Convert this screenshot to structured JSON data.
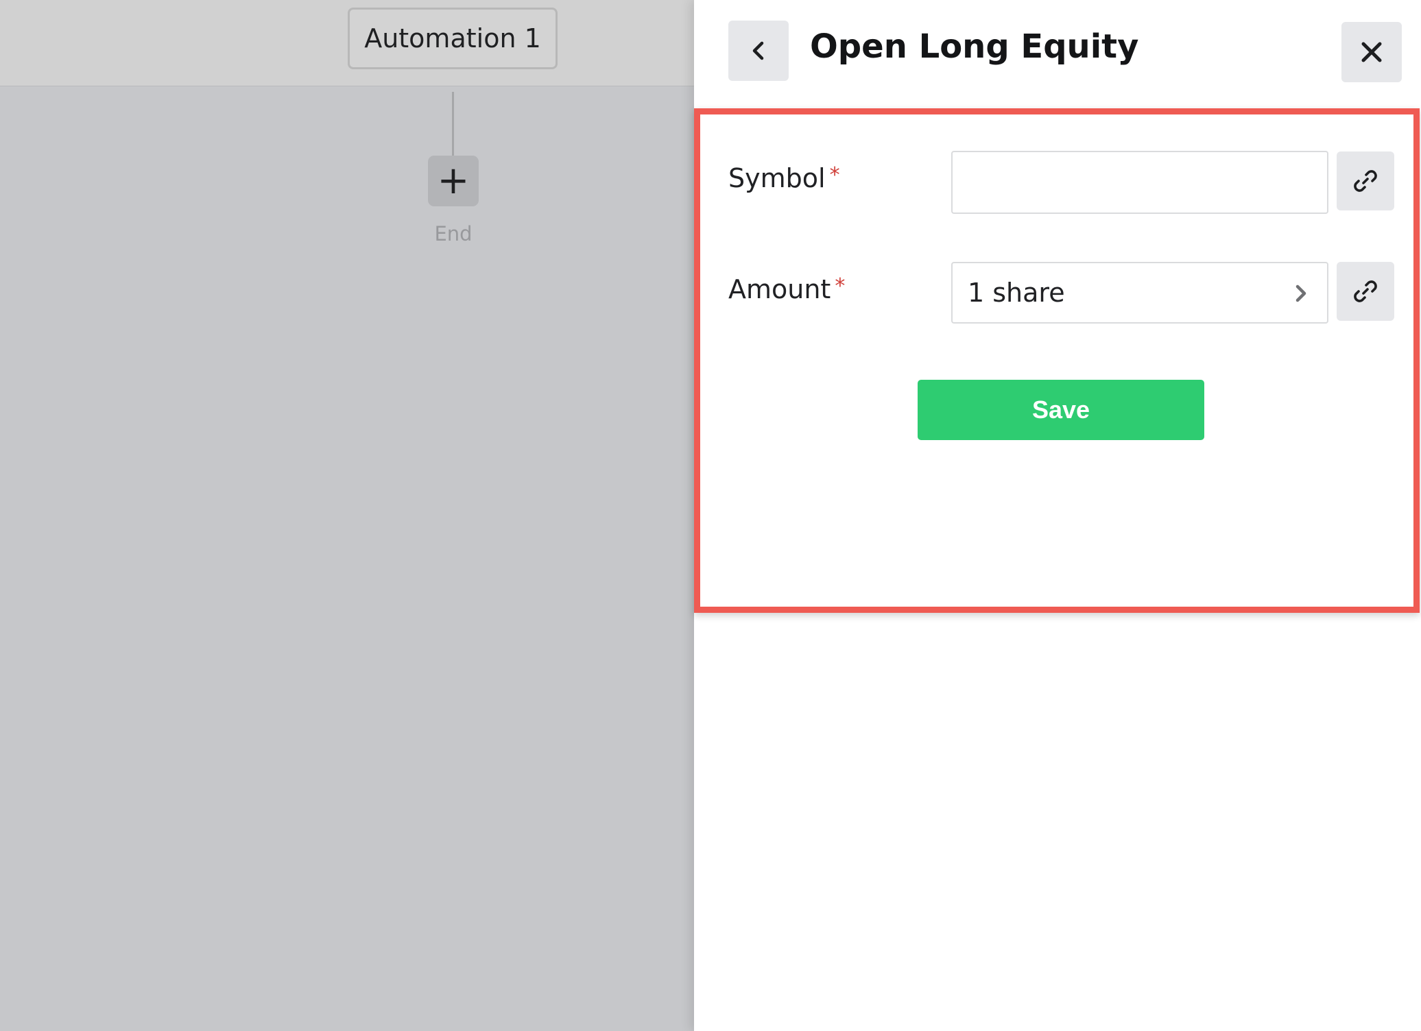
{
  "canvas": {
    "automation_title": "Automation 1",
    "add_step_symbol": "+",
    "end_label": "End",
    "colors": {
      "background": "#c6c7ca",
      "header": "#d1d1d1"
    }
  },
  "panel": {
    "title": "Open Long Equity",
    "back_icon": "chevron-left-icon",
    "close_icon": "close-icon",
    "fields": {
      "symbol": {
        "label": "Symbol",
        "required_mark": "*",
        "value": "",
        "placeholder": "",
        "link_icon": "link-icon"
      },
      "amount": {
        "label": "Amount",
        "required_mark": "*",
        "value": "1 share",
        "open_icon": "chevron-right-icon",
        "link_icon": "link-icon"
      }
    },
    "save_label": "Save",
    "colors": {
      "save_button": "#2ecc71",
      "required_mark": "#d0403a",
      "highlight_border": "#ef5b53"
    }
  }
}
